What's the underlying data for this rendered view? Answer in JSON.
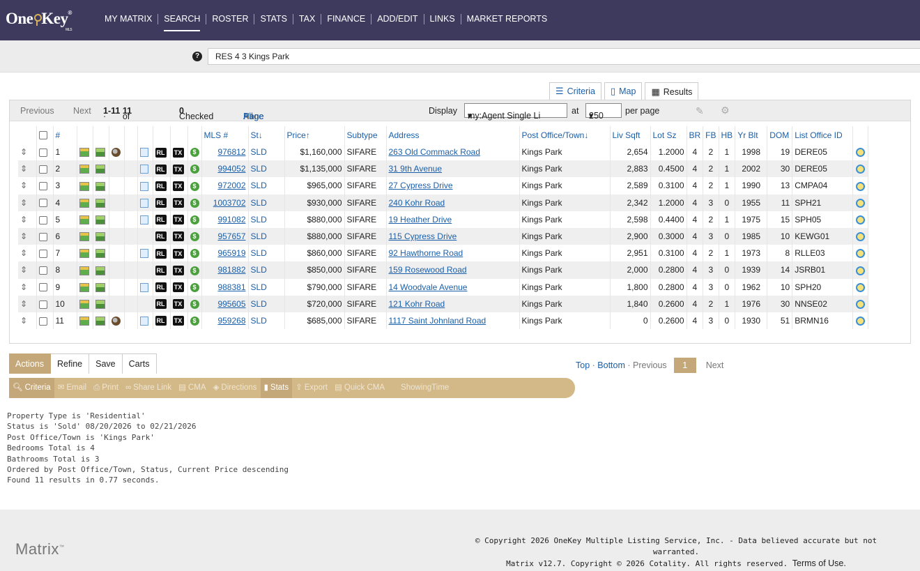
{
  "app": {
    "logo_text": "One",
    "logo_text2": "Key",
    "logo_tm": "®",
    "logo_sub": "MLS"
  },
  "nav": [
    "MY MATRIX",
    "SEARCH",
    "ROSTER",
    "STATS",
    "TAX",
    "FINANCE",
    "ADD/EDIT",
    "LINKS",
    "MARKET REPORTS"
  ],
  "nav_active": "SEARCH",
  "search": {
    "value": "RES 4 3 Kings Park",
    "help": "?"
  },
  "viewtabs": [
    {
      "label": "Criteria",
      "icon": "sliders-icon"
    },
    {
      "label": "Map",
      "icon": "map-icon"
    },
    {
      "label": "Results",
      "icon": "table-icon"
    }
  ],
  "pager": {
    "previous": "Previous",
    "next": "Next",
    "range_prefix": "·",
    "range": "1-11",
    "of": "of",
    "total": "11",
    "checked_label": "Checked",
    "checked_count": "0",
    "all": "All",
    "none": "None",
    "page": "Page",
    "sep": "·",
    "display_label": "Display",
    "display_value": "my:Agent Single Li",
    "at": "at",
    "per_page_value": "250",
    "per_page_label": "per page"
  },
  "columns": [
    "#",
    "MLS #",
    "St",
    "Price",
    "Subtype",
    "Address",
    "Post Office/Town",
    "Liv Sqft",
    "Lot Sz",
    "BR",
    "FB",
    "HB",
    "Yr Blt",
    "DOM",
    "List Office ID"
  ],
  "rows": [
    {
      "n": "1",
      "mls": "976812",
      "st": "SLD",
      "price": "$1,160,000",
      "sub": "SIFARE",
      "addr": "263 Old Commack Road",
      "town": "Kings Park",
      "sqft": "2,654",
      "lot": "1.2000",
      "br": "4",
      "fb": "2",
      "hb": "1",
      "yr": "1998",
      "dom": "19",
      "office": "DERE05",
      "virt": true,
      "copy": true
    },
    {
      "n": "2",
      "mls": "994052",
      "st": "SLD",
      "price": "$1,135,000",
      "sub": "SIFARE",
      "addr": "31 9th Avenue",
      "town": "Kings Park",
      "sqft": "2,883",
      "lot": "0.4500",
      "br": "4",
      "fb": "2",
      "hb": "1",
      "yr": "2002",
      "dom": "30",
      "office": "DERE05",
      "virt": false,
      "copy": true
    },
    {
      "n": "3",
      "mls": "972002",
      "st": "SLD",
      "price": "$965,000",
      "sub": "SIFARE",
      "addr": "27 Cypress Drive",
      "town": "Kings Park",
      "sqft": "2,589",
      "lot": "0.3100",
      "br": "4",
      "fb": "2",
      "hb": "1",
      "yr": "1990",
      "dom": "13",
      "office": "CMPA04",
      "virt": false,
      "copy": true
    },
    {
      "n": "4",
      "mls": "1003702",
      "st": "SLD",
      "price": "$930,000",
      "sub": "SIFARE",
      "addr": "240 Kohr Road",
      "town": "Kings Park",
      "sqft": "2,342",
      "lot": "1.2000",
      "br": "4",
      "fb": "3",
      "hb": "0",
      "yr": "1955",
      "dom": "11",
      "office": "SPH21",
      "virt": false,
      "copy": true
    },
    {
      "n": "5",
      "mls": "991082",
      "st": "SLD",
      "price": "$880,000",
      "sub": "SIFARE",
      "addr": "19 Heather Drive",
      "town": "Kings Park",
      "sqft": "2,598",
      "lot": "0.4400",
      "br": "4",
      "fb": "2",
      "hb": "1",
      "yr": "1975",
      "dom": "15",
      "office": "SPH05",
      "virt": false,
      "copy": true
    },
    {
      "n": "6",
      "mls": "957657",
      "st": "SLD",
      "price": "$880,000",
      "sub": "SIFARE",
      "addr": "115 Cypress Drive",
      "town": "Kings Park",
      "sqft": "2,900",
      "lot": "0.3000",
      "br": "4",
      "fb": "3",
      "hb": "0",
      "yr": "1985",
      "dom": "10",
      "office": "KEWG01",
      "virt": false,
      "copy": false
    },
    {
      "n": "7",
      "mls": "965919",
      "st": "SLD",
      "price": "$860,000",
      "sub": "SIFARE",
      "addr": "92 Hawthorne Road",
      "town": "Kings Park",
      "sqft": "2,951",
      "lot": "0.3100",
      "br": "4",
      "fb": "2",
      "hb": "1",
      "yr": "1973",
      "dom": "8",
      "office": "RLLE03",
      "virt": false,
      "copy": true
    },
    {
      "n": "8",
      "mls": "981882",
      "st": "SLD",
      "price": "$850,000",
      "sub": "SIFARE",
      "addr": "159 Rosewood Road",
      "town": "Kings Park",
      "sqft": "2,000",
      "lot": "0.2800",
      "br": "4",
      "fb": "3",
      "hb": "0",
      "yr": "1939",
      "dom": "14",
      "office": "JSRB01",
      "virt": false,
      "copy": false
    },
    {
      "n": "9",
      "mls": "988381",
      "st": "SLD",
      "price": "$790,000",
      "sub": "SIFARE",
      "addr": "14 Woodvale Avenue",
      "town": "Kings Park",
      "sqft": "1,800",
      "lot": "0.2800",
      "br": "4",
      "fb": "3",
      "hb": "0",
      "yr": "1962",
      "dom": "10",
      "office": "SPH20",
      "virt": false,
      "copy": true
    },
    {
      "n": "10",
      "mls": "995605",
      "st": "SLD",
      "price": "$720,000",
      "sub": "SIFARE",
      "addr": "121 Kohr Road",
      "town": "Kings Park",
      "sqft": "1,840",
      "lot": "0.2600",
      "br": "4",
      "fb": "2",
      "hb": "1",
      "yr": "1976",
      "dom": "30",
      "office": "NNSE02",
      "virt": false,
      "copy": false
    },
    {
      "n": "11",
      "mls": "959268",
      "st": "SLD",
      "price": "$685,000",
      "sub": "SIFARE",
      "addr": "1117 Saint Johnland Road",
      "town": "Kings Park",
      "sqft": "0",
      "lot": "0.2600",
      "br": "4",
      "fb": "3",
      "hb": "0",
      "yr": "1930",
      "dom": "51",
      "office": "BRMN16",
      "virt": true,
      "copy": true
    }
  ],
  "icons": {
    "rl": "RL",
    "tx": "TX",
    "dollar": "$"
  },
  "action_tabs": [
    "Actions",
    "Refine",
    "Save",
    "Carts"
  ],
  "actions": [
    {
      "label": "Criteria",
      "icon": "magnifier-icon",
      "on": true
    },
    {
      "label": "Email",
      "icon": "email-icon",
      "on": false
    },
    {
      "label": "Print",
      "icon": "print-icon",
      "on": false
    },
    {
      "label": "Share Link",
      "icon": "link-icon",
      "on": false
    },
    {
      "label": "CMA",
      "icon": "cma-icon",
      "on": false
    },
    {
      "label": "Directions",
      "icon": "directions-icon",
      "on": false
    },
    {
      "label": "Stats",
      "icon": "bar-chart-icon",
      "on": true
    },
    {
      "label": "Export",
      "icon": "export-icon",
      "on": false
    },
    {
      "label": "Quick CMA",
      "icon": "quick-cma-icon",
      "on": false
    },
    {
      "label": "ShowingTime",
      "icon": "",
      "on": false
    }
  ],
  "bottom_pager": {
    "top": "Top",
    "bottom": "Bottom",
    "previous": "Previous",
    "page": "1",
    "next": "Next",
    "sep": "·"
  },
  "criteria_lines": [
    "Property Type is 'Residential'",
    "Status is 'Sold' 08/20/2026 to 02/21/2026",
    "Post Office/Town is 'Kings Park'",
    "Bedrooms Total is 4",
    "Bathrooms Total is 3",
    "Ordered by Post Office/Town, Status, Current Price descending",
    "Found 11 results in 0.77 seconds."
  ],
  "footer": {
    "matrix_logo": "Matrix",
    "matrix_tm": "™",
    "line1": "© Copyright 2026 OneKey Multiple Listing Service, Inc. - Data believed accurate but not warranted.",
    "line2": "Matrix v12.7. Copyright © 2026 Cotality. All rights reserved.",
    "terms": "Terms of Use."
  },
  "colors": {
    "nav_bg": "#3d3a5e",
    "accent_gold": "#c5a87a",
    "link_blue": "#1a5fa8"
  }
}
